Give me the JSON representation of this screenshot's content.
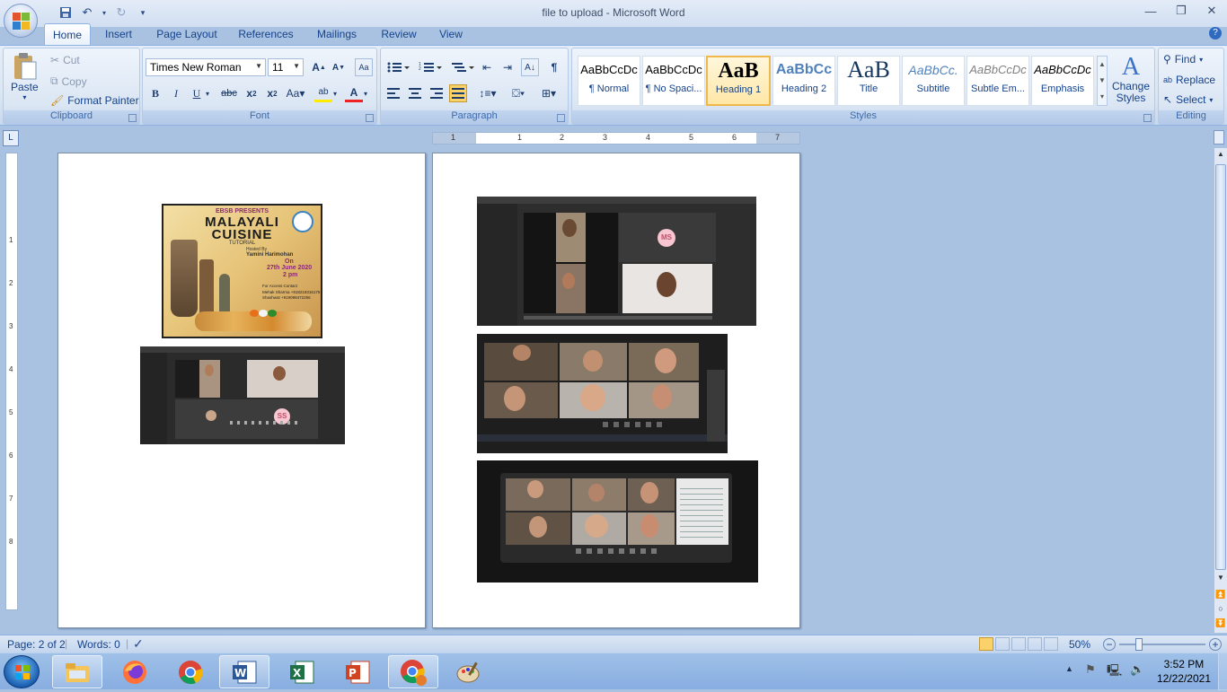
{
  "window": {
    "title": "file to upload - Microsoft Word"
  },
  "qat": {
    "save": "save-icon",
    "undo": "undo-icon",
    "redo": "redo-icon",
    "customize": "▾"
  },
  "tabs": [
    "Home",
    "Insert",
    "Page Layout",
    "References",
    "Mailings",
    "Review",
    "View"
  ],
  "clipboard": {
    "group": "Clipboard",
    "paste": "Paste",
    "cut": "Cut",
    "copy": "Copy",
    "format_painter": "Format Painter"
  },
  "font": {
    "group": "Font",
    "family": "Times New Roman",
    "size": "11"
  },
  "paragraph": {
    "group": "Paragraph"
  },
  "styles": {
    "group": "Styles",
    "items": [
      {
        "preview": "AaBbCcDc",
        "name": "¶ Normal"
      },
      {
        "preview": "AaBbCcDc",
        "name": "¶ No Spaci..."
      },
      {
        "preview": "AaB",
        "name": "Heading 1"
      },
      {
        "preview": "AaBbCc",
        "name": "Heading 2"
      },
      {
        "preview": "AaB",
        "name": "Title"
      },
      {
        "preview": "AaBbCc.",
        "name": "Subtitle"
      },
      {
        "preview": "AaBbCcDc",
        "name": "Subtle Em..."
      },
      {
        "preview": "AaBbCcDc",
        "name": "Emphasis"
      }
    ],
    "change": "Change Styles"
  },
  "editing": {
    "group": "Editing",
    "find": "Find",
    "replace": "Replace",
    "select": "Select"
  },
  "ruler": {
    "h_numbers": [
      "1",
      "1",
      "2",
      "3",
      "4",
      "5",
      "6",
      "7"
    ],
    "v_numbers": [
      "1",
      "2",
      "3",
      "4",
      "5",
      "6",
      "7",
      "8"
    ]
  },
  "poster": {
    "line1": "EBSB PRESENTS",
    "line2": "MALAYALI",
    "line3": "CUISINE",
    "line4": "TUTORIAL",
    "line5": "Hosted By",
    "host": "Yamini Harimohan",
    "on": "On",
    "date": "27th June 2020",
    "time": "2 pm",
    "contact": "For Access Contact",
    "c1": "Mehak Sharma +918219316175",
    "c2": "Shashwat +919098472256"
  },
  "call_avatars": {
    "a1": "SS",
    "a2": "MS"
  },
  "status": {
    "page": "Page: 2 of 2",
    "words": "Words: 0",
    "zoom": "50%"
  },
  "taskbar": {
    "time": "3:52 PM",
    "date": "12/22/2021"
  }
}
